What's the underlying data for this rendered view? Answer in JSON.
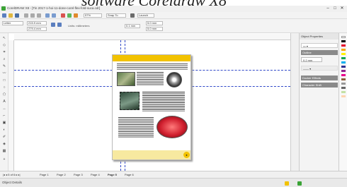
{
  "banner": {
    "text": "software Coreldraw X8"
  },
  "window": {
    "title": "CorelDRAW X8 - [Tin 2017-1-hoi-11-done-corel-flex-fold-suca.cdr]",
    "minimize": "–",
    "maximize": "□",
    "close": "✕"
  },
  "toolbar": {
    "zoom_value": "57%",
    "snap_label": "Snap To",
    "launch_label": "Launch"
  },
  "propbar": {
    "paper_size": "Letter",
    "width": "215.9 mm",
    "height": "279.4 mm",
    "units": "Units: millimeters",
    "nudge": "0.1 mm",
    "dup_x": "5.0 mm",
    "dup_y": "5.0 mm"
  },
  "docker": {
    "title": "Object Properties",
    "tab1": "Outline",
    "width_value": "0.2 mm",
    "section1": "Docker Effects",
    "section2": "Character Shift"
  },
  "pagebar": {
    "pages": [
      "Page 1",
      "Page 2",
      "Page 3",
      "Page 4",
      "Page 5",
      "Page 6"
    ],
    "active_index": 4
  },
  "status": {
    "text": "Object Details"
  },
  "colors": {
    "accent": "#f2c200",
    "guide": "#3048c8",
    "app_green": "#3aa336"
  }
}
